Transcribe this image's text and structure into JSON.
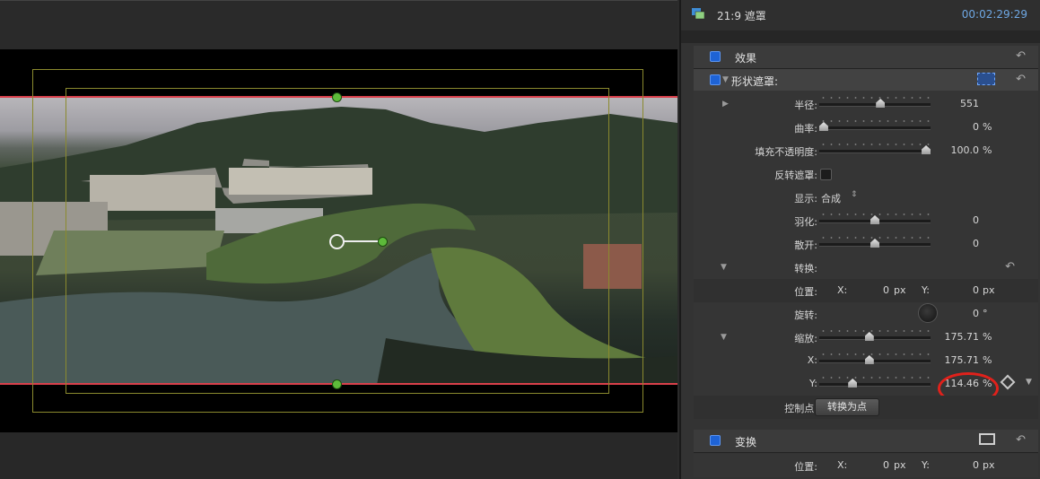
{
  "app": {
    "accent": "#1e63d6",
    "timecode_color": "#6fa8e4",
    "highlight_color": "#e0211b"
  },
  "inspector": {
    "clip_name": "21:9 遮罩",
    "timecode": "00:02:29:29",
    "effects_header": "效果",
    "shape_mask": {
      "title": "形状遮罩:",
      "radius": {
        "label": "半径:",
        "value": "551",
        "unit": "",
        "level": 0.55
      },
      "curvature": {
        "label": "曲率:",
        "value": "0",
        "unit": "%",
        "level": 0.0
      },
      "fill_opacity": {
        "label": "填充不透明度:",
        "value": "100.0",
        "unit": "%",
        "level": 1.0
      },
      "invert_mask": {
        "label": "反转遮罩:",
        "checked": false
      },
      "display": {
        "label": "显示:",
        "value": "合成"
      },
      "feather": {
        "label": "羽化:",
        "value": "0",
        "level": 0.5
      },
      "falloff": {
        "label": "散开:",
        "value": "0",
        "level": 0.5
      },
      "transform": {
        "title": "转换:",
        "position": {
          "label": "位置:",
          "x_label": "X:",
          "x": "0",
          "y_label": "Y:",
          "y": "0",
          "unit": "px"
        },
        "rotation": {
          "label": "旋转:",
          "value": "0",
          "unit": "°"
        },
        "scale": {
          "label": "缩放:",
          "value": "175.71",
          "unit": "%",
          "level": 0.45
        },
        "scale_x": {
          "label": "X:",
          "value": "175.71",
          "unit": "%",
          "level": 0.45
        },
        "scale_y": {
          "label": "Y:",
          "value": "114.46",
          "unit": "%",
          "level": 0.3
        },
        "control_points": {
          "label": "控制点:",
          "button": "转换为点"
        }
      }
    },
    "transform_section": {
      "title": "变换",
      "position": {
        "label": "位置:",
        "x_label": "X:",
        "x": "0",
        "y_label": "Y:",
        "y": "0",
        "unit": "px"
      }
    }
  }
}
